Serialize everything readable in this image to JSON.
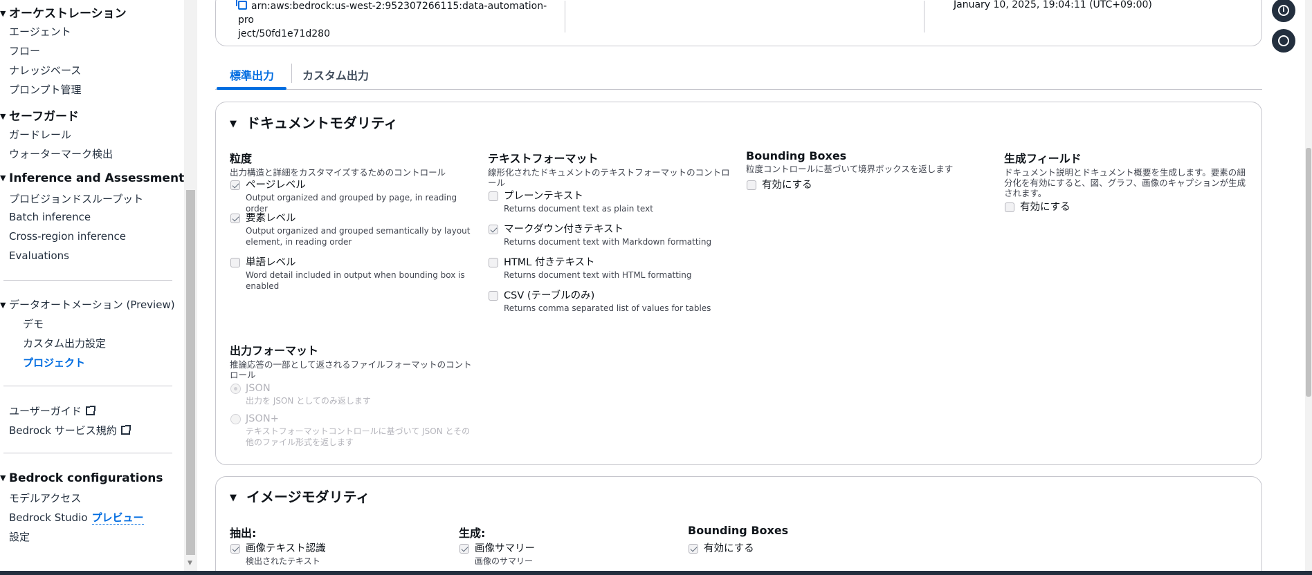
{
  "sidebar": {
    "orchestration": {
      "title": "オーケストレーション",
      "items": [
        "エージェント",
        "フロー",
        "ナレッジベース",
        "プロンプト管理"
      ]
    },
    "safeguard": {
      "title": "セーフガード",
      "items": [
        "ガードレール",
        "ウォーターマーク検出"
      ]
    },
    "inference": {
      "title": "Inference and Assessment",
      "items": [
        "プロビジョンドスループット",
        "Batch inference",
        "Cross-region inference",
        "Evaluations"
      ]
    },
    "data_automation": {
      "title": "データオートメーション (Preview)",
      "items": [
        "デモ",
        "カスタム出力設定",
        "プロジェクト"
      ]
    },
    "links": {
      "user_guide": "ユーザーガイド",
      "terms": "Bedrock サービス規約"
    },
    "configurations": {
      "title": "Bedrock configurations",
      "model_access": "モデルアクセス",
      "studio": "Bedrock Studio",
      "studio_badge": "プレビュー",
      "settings": "設定"
    }
  },
  "header_panel": {
    "arn_line1": "arn:aws:bedrock:us-west-2:952307266115:data-automation-pro",
    "arn_line2": "ject/50fd1e71d280",
    "date": "January 10, 2025, 19:04:11 (UTC+09:00)"
  },
  "tabs": [
    "標準出力",
    "カスタム出力"
  ],
  "document_modality": {
    "title": "ドキュメントモダリティ",
    "granularity": {
      "title": "粒度",
      "desc": "出力構造と詳細をカスタマイズするためのコントロール",
      "options": [
        {
          "label": "ページレベル",
          "desc": "Output organized and grouped by page, in reading order",
          "checked": true
        },
        {
          "label": "要素レベル",
          "desc": "Output organized and grouped semantically by layout element, in reading order",
          "checked": true
        },
        {
          "label": "単語レベル",
          "desc": "Word detail included in output when bounding box is enabled",
          "checked": false
        }
      ]
    },
    "text_format": {
      "title": "テキストフォーマット",
      "desc": "線形化されたドキュメントのテキストフォーマットのコントロール",
      "options": [
        {
          "label": "プレーンテキスト",
          "desc": "Returns document text as plain text",
          "checked": false
        },
        {
          "label": "マークダウン付きテキスト",
          "desc": "Returns document text with Markdown formatting",
          "checked": true
        },
        {
          "label": "HTML 付きテキスト",
          "desc": "Returns document text with HTML formatting",
          "checked": false
        },
        {
          "label": "CSV (テーブルのみ)",
          "desc": "Returns comma separated list of values for tables",
          "checked": false
        }
      ]
    },
    "bounding_boxes": {
      "title": "Bounding Boxes",
      "desc": "粒度コントロールに基づいて境界ボックスを返します",
      "option": "有効にする"
    },
    "generative_fields": {
      "title": "生成フィールド",
      "desc": "ドキュメント説明とドキュメント概要を生成します。要素の細分化を有効にすると、図、グラフ、画像のキャプションが生成されます。",
      "option": "有効にする"
    },
    "output_format": {
      "title": "出力フォーマット",
      "desc": "推論応答の一部として返されるファイルフォーマットのコントロール",
      "options": [
        {
          "label": "JSON",
          "desc": "出力を JSON としてのみ返します",
          "selected": true
        },
        {
          "label": "JSON+",
          "desc": "テキストフォーマットコントロールに基づいて JSON とその他のファイル形式を返します",
          "selected": false
        }
      ]
    }
  },
  "image_modality": {
    "title": "イメージモダリティ",
    "extraction": {
      "title": "抽出:",
      "option": "画像テキスト認識",
      "desc": "検出されたテキスト"
    },
    "generation": {
      "title": "生成:",
      "option": "画像サマリー",
      "desc": "画像のサマリー"
    },
    "bounding_boxes": {
      "title": "Bounding Boxes",
      "option": "有効にする"
    }
  },
  "rail": {
    "info_icon": "i"
  }
}
